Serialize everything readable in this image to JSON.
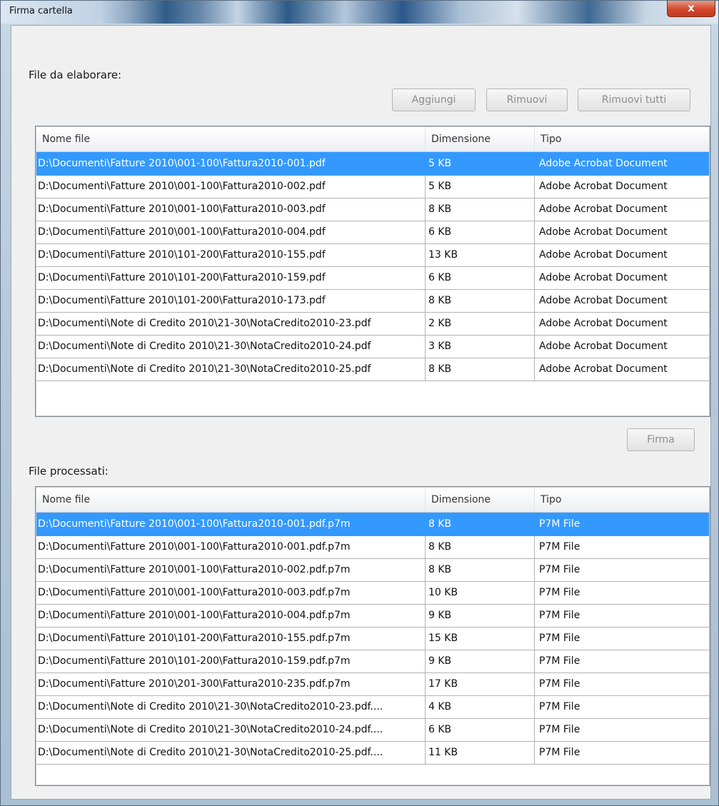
{
  "window": {
    "title": "Firma cartella",
    "close_glyph": "x"
  },
  "input_section": {
    "label": "File da elaborare:",
    "buttons": {
      "add": "Aggiungi",
      "remove": "Rimuovi",
      "remove_all": "Rimuovi tutti"
    },
    "columns": [
      "Nome file",
      "Dimensione",
      "Tipo"
    ],
    "rows": [
      {
        "name": "D:\\Documenti\\Fatture 2010\\001-100\\Fattura2010-001.pdf",
        "size": "5 KB",
        "type": "Adobe Acrobat Document",
        "selected": true
      },
      {
        "name": "D:\\Documenti\\Fatture 2010\\001-100\\Fattura2010-002.pdf",
        "size": "5 KB",
        "type": "Adobe Acrobat Document"
      },
      {
        "name": "D:\\Documenti\\Fatture 2010\\001-100\\Fattura2010-003.pdf",
        "size": "8 KB",
        "type": "Adobe Acrobat Document"
      },
      {
        "name": "D:\\Documenti\\Fatture 2010\\001-100\\Fattura2010-004.pdf",
        "size": "6 KB",
        "type": "Adobe Acrobat Document"
      },
      {
        "name": "D:\\Documenti\\Fatture 2010\\101-200\\Fattura2010-155.pdf",
        "size": "13 KB",
        "type": "Adobe Acrobat Document"
      },
      {
        "name": "D:\\Documenti\\Fatture 2010\\101-200\\Fattura2010-159.pdf",
        "size": "6 KB",
        "type": "Adobe Acrobat Document"
      },
      {
        "name": "D:\\Documenti\\Fatture 2010\\101-200\\Fattura2010-173.pdf",
        "size": "8 KB",
        "type": "Adobe Acrobat Document"
      },
      {
        "name": "D:\\Documenti\\Note di Credito 2010\\21-30\\NotaCredito2010-23.pdf",
        "size": "2 KB",
        "type": "Adobe Acrobat Document"
      },
      {
        "name": "D:\\Documenti\\Note di Credito 2010\\21-30\\NotaCredito2010-24.pdf",
        "size": "3 KB",
        "type": "Adobe Acrobat Document"
      },
      {
        "name": "D:\\Documenti\\Note di Credito 2010\\21-30\\NotaCredito2010-25.pdf",
        "size": "8 KB",
        "type": "Adobe Acrobat Document"
      }
    ]
  },
  "sign_button": "Firma",
  "output_section": {
    "label": "File processati:",
    "columns": [
      "Nome file",
      "Dimensione",
      "Tipo"
    ],
    "rows": [
      {
        "name": "D:\\Documenti\\Fatture 2010\\001-100\\Fattura2010-001.pdf.p7m",
        "size": "8 KB",
        "type": "P7M File",
        "selected": true
      },
      {
        "name": "D:\\Documenti\\Fatture 2010\\001-100\\Fattura2010-001.pdf.p7m",
        "size": "8 KB",
        "type": "P7M File"
      },
      {
        "name": "D:\\Documenti\\Fatture 2010\\001-100\\Fattura2010-002.pdf.p7m",
        "size": "8 KB",
        "type": "P7M File"
      },
      {
        "name": "D:\\Documenti\\Fatture 2010\\001-100\\Fattura2010-003.pdf.p7m",
        "size": "10 KB",
        "type": "P7M File"
      },
      {
        "name": "D:\\Documenti\\Fatture 2010\\001-100\\Fattura2010-004.pdf.p7m",
        "size": "9 KB",
        "type": "P7M File"
      },
      {
        "name": "D:\\Documenti\\Fatture 2010\\101-200\\Fattura2010-155.pdf.p7m",
        "size": "15 KB",
        "type": "P7M File"
      },
      {
        "name": "D:\\Documenti\\Fatture 2010\\101-200\\Fattura2010-159.pdf.p7m",
        "size": "9 KB",
        "type": "P7M File"
      },
      {
        "name": "D:\\Documenti\\Fatture 2010\\201-300\\Fattura2010-235.pdf.p7m",
        "size": "17 KB",
        "type": "P7M File"
      },
      {
        "name": "D:\\Documenti\\Note di Credito 2010\\21-30\\NotaCredito2010-23.pdf....",
        "size": "4 KB",
        "type": "P7M File"
      },
      {
        "name": "D:\\Documenti\\Note di Credito 2010\\21-30\\NotaCredito2010-24.pdf....",
        "size": "6 KB",
        "type": "P7M File"
      },
      {
        "name": "D:\\Documenti\\Note di Credito 2010\\21-30\\NotaCredito2010-25.pdf....",
        "size": "11 KB",
        "type": "P7M File"
      }
    ]
  },
  "colors": {
    "selection": "#3399ff",
    "window_bg": "#f0f0f0",
    "close_button": "#d2462c"
  }
}
